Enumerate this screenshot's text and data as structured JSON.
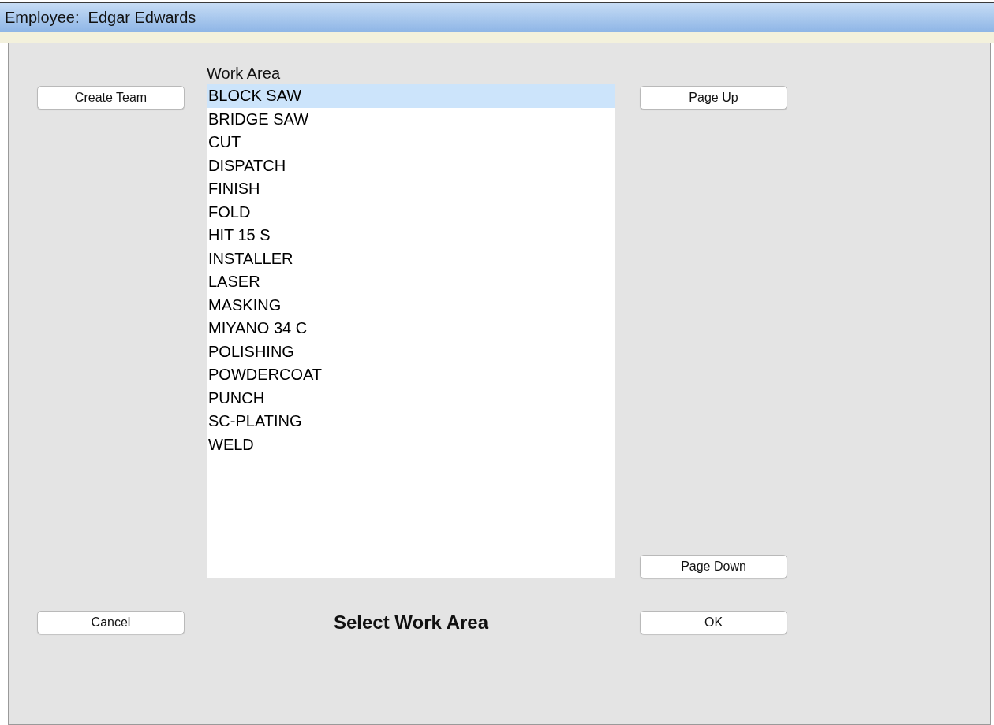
{
  "title_bar": {
    "text": "Employee:  Edgar Edwards"
  },
  "work_area_list": {
    "label": "Work Area",
    "items": [
      {
        "text": "BLOCK SAW",
        "selected": true
      },
      {
        "text": "BRIDGE SAW",
        "selected": false
      },
      {
        "text": "CUT",
        "selected": false
      },
      {
        "text": "DISPATCH",
        "selected": false
      },
      {
        "text": "FINISH",
        "selected": false
      },
      {
        "text": "FOLD",
        "selected": false
      },
      {
        "text": "HIT 15 S",
        "selected": false
      },
      {
        "text": "INSTALLER",
        "selected": false
      },
      {
        "text": "LASER",
        "selected": false
      },
      {
        "text": "MASKING",
        "selected": false
      },
      {
        "text": "MIYANO 34 C",
        "selected": false
      },
      {
        "text": "POLISHING",
        "selected": false
      },
      {
        "text": "POWDERCOAT",
        "selected": false
      },
      {
        "text": "PUNCH",
        "selected": false
      },
      {
        "text": "SC-PLATING",
        "selected": false
      },
      {
        "text": "WELD",
        "selected": false
      }
    ]
  },
  "buttons": {
    "create_team": "Create Team",
    "page_up": "Page Up",
    "page_down": "Page Down",
    "cancel": "Cancel",
    "ok": "OK"
  },
  "prompt": "Select Work Area"
}
